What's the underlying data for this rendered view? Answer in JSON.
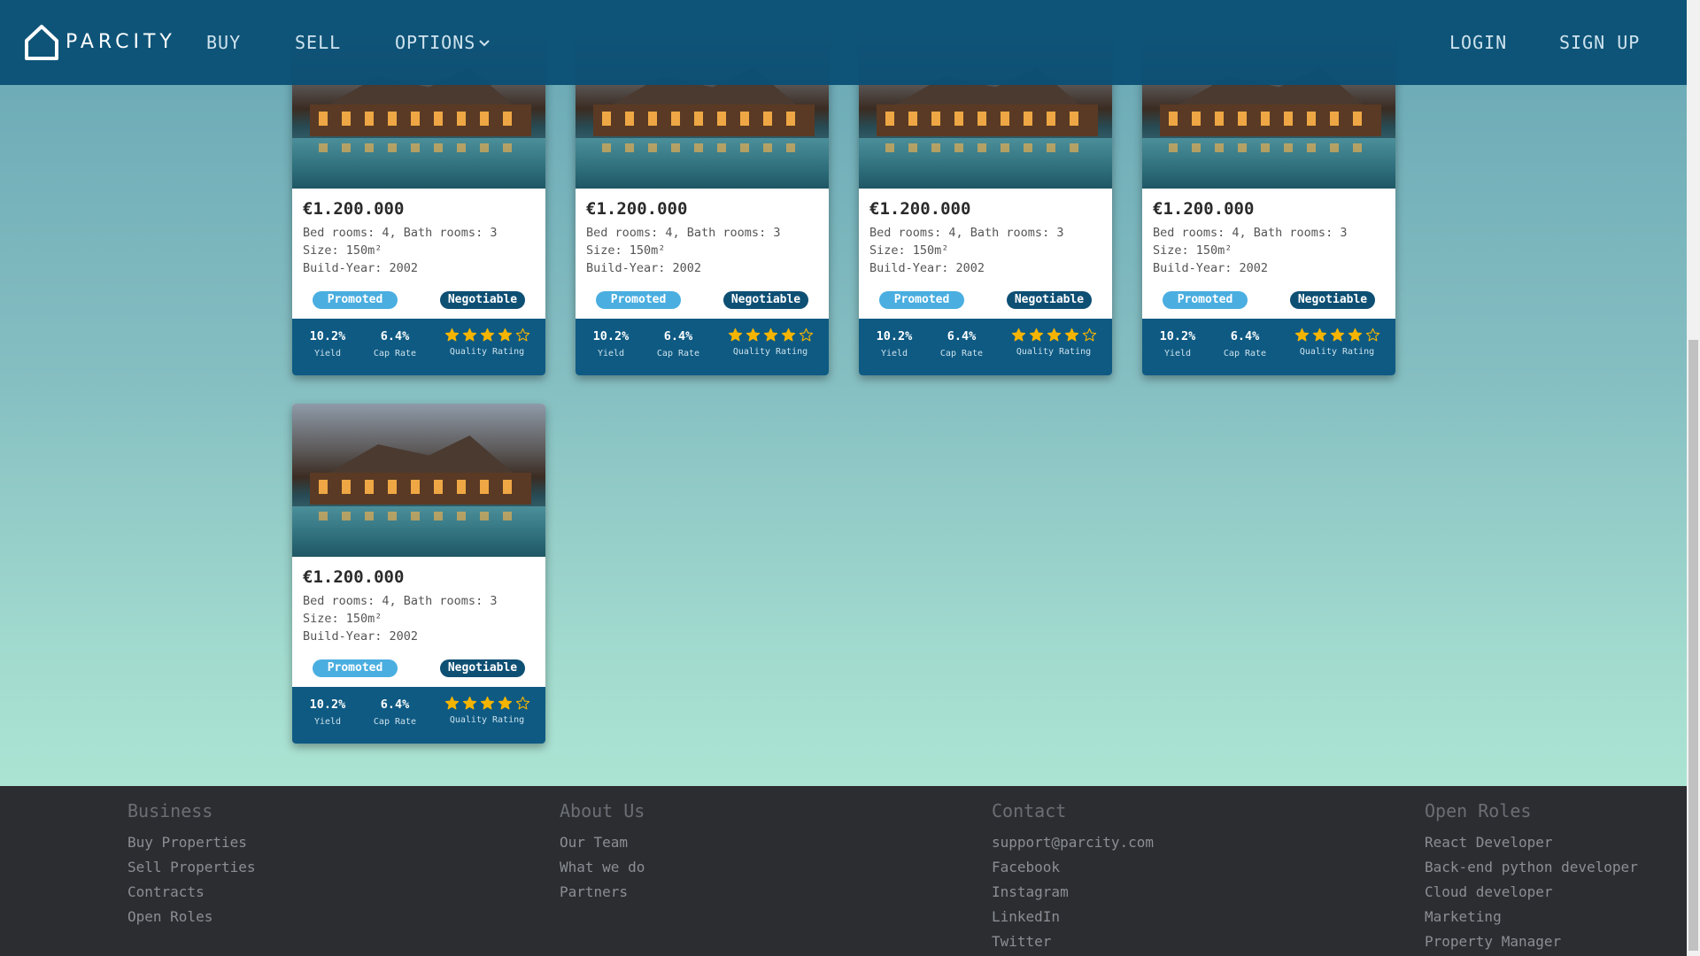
{
  "nav": {
    "logo_text": "PARCITY",
    "buy": "BUY",
    "sell": "SELL",
    "options": "OPTIONS",
    "login": "LOGIN",
    "signup": "SIGN UP"
  },
  "listings": [
    {
      "price": "€1.200.000",
      "rooms": "Bed rooms: 4, Bath rooms: 3",
      "size": "Size: 150m²",
      "build": "Build-Year: 2002",
      "promoted": "Promoted",
      "negotiable": "Negotiable",
      "yield": "10.2%",
      "yield_label": "Yield",
      "cap": "6.4%",
      "cap_label": "Cap Rate",
      "rating": 4,
      "rating_max": 5,
      "rating_label": "Quality Rating"
    },
    {
      "price": "€1.200.000",
      "rooms": "Bed rooms: 4, Bath rooms: 3",
      "size": "Size: 150m²",
      "build": "Build-Year: 2002",
      "promoted": "Promoted",
      "negotiable": "Negotiable",
      "yield": "10.2%",
      "yield_label": "Yield",
      "cap": "6.4%",
      "cap_label": "Cap Rate",
      "rating": 4,
      "rating_max": 5,
      "rating_label": "Quality Rating"
    },
    {
      "price": "€1.200.000",
      "rooms": "Bed rooms: 4, Bath rooms: 3",
      "size": "Size: 150m²",
      "build": "Build-Year: 2002",
      "promoted": "Promoted",
      "negotiable": "Negotiable",
      "yield": "10.2%",
      "yield_label": "Yield",
      "cap": "6.4%",
      "cap_label": "Cap Rate",
      "rating": 4,
      "rating_max": 5,
      "rating_label": "Quality Rating"
    },
    {
      "price": "€1.200.000",
      "rooms": "Bed rooms: 4, Bath rooms: 3",
      "size": "Size: 150m²",
      "build": "Build-Year: 2002",
      "promoted": "Promoted",
      "negotiable": "Negotiable",
      "yield": "10.2%",
      "yield_label": "Yield",
      "cap": "6.4%",
      "cap_label": "Cap Rate",
      "rating": 4,
      "rating_max": 5,
      "rating_label": "Quality Rating"
    },
    {
      "price": "€1.200.000",
      "rooms": "Bed rooms: 4, Bath rooms: 3",
      "size": "Size: 150m²",
      "build": "Build-Year: 2002",
      "promoted": "Promoted",
      "negotiable": "Negotiable",
      "yield": "10.2%",
      "yield_label": "Yield",
      "cap": "6.4%",
      "cap_label": "Cap Rate",
      "rating": 4,
      "rating_max": 5,
      "rating_label": "Quality Rating"
    }
  ],
  "footer": {
    "business": {
      "title": "Business",
      "links": [
        "Buy Properties",
        "Sell Properties",
        "Contracts",
        "Open Roles"
      ]
    },
    "about": {
      "title": "About Us",
      "links": [
        "Our Team",
        "What we do",
        "Partners"
      ]
    },
    "contact": {
      "title": "Contact",
      "links": [
        "support@parcity.com",
        "Facebook",
        "Instagram",
        "LinkedIn",
        "Twitter"
      ]
    },
    "roles": {
      "title": "Open Roles",
      "links": [
        "React Developer",
        "Back-end python developer",
        "Cloud developer",
        "Marketing",
        "Property Manager"
      ]
    }
  },
  "colors": {
    "navbar": "#0a5076",
    "promoted": "#4aaee0",
    "negotiable": "#0e4f74",
    "card_footer": "#0e5a83",
    "star": "#f5b400",
    "site_footer": "#2b2d31"
  },
  "icons": {
    "logo": "house-outline-icon",
    "options_caret": "chevron-down-icon",
    "rating": "star-icon"
  }
}
